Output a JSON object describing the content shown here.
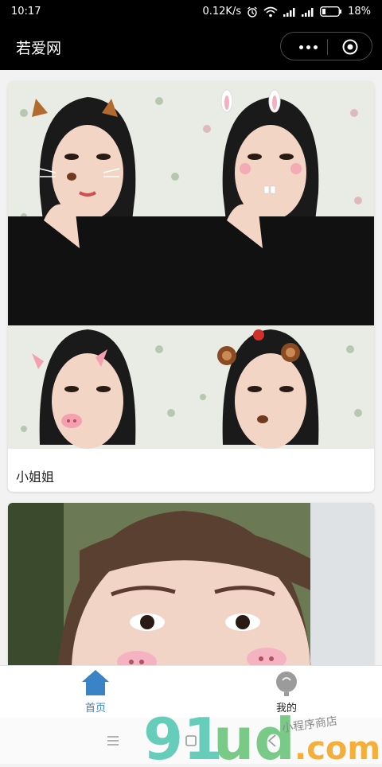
{
  "status_bar": {
    "time": "10:17",
    "network_speed": "0.12K/s",
    "battery_percent": "18%",
    "icons": [
      "alarm-icon",
      "wifi-icon",
      "signal-icon",
      "signal-icon",
      "battery-icon"
    ]
  },
  "nav": {
    "title": "若爱网",
    "more_icon": "more-dots-icon",
    "close_icon": "target-close-icon"
  },
  "feed": {
    "cards": [
      {
        "caption": "小姐姐",
        "photos": [
          "cat-ears-filter",
          "bunny-ears-filter",
          "pig-ears-filter",
          "bear-ears-filter"
        ]
      },
      {
        "caption": "",
        "photos": [
          "pig-nose-filter-closeup"
        ]
      }
    ]
  },
  "tabbar": {
    "items": [
      {
        "label": "首页",
        "icon": "home-icon",
        "active": true
      },
      {
        "label": "我的",
        "icon": "user-icon",
        "active": false
      }
    ],
    "active_color": "#3a83c4"
  },
  "system_nav": {
    "icons": [
      "menu-icon",
      "home-square-icon",
      "back-icon"
    ]
  },
  "watermark": {
    "brand": "91ud.com",
    "tagline": "小程序商店"
  }
}
